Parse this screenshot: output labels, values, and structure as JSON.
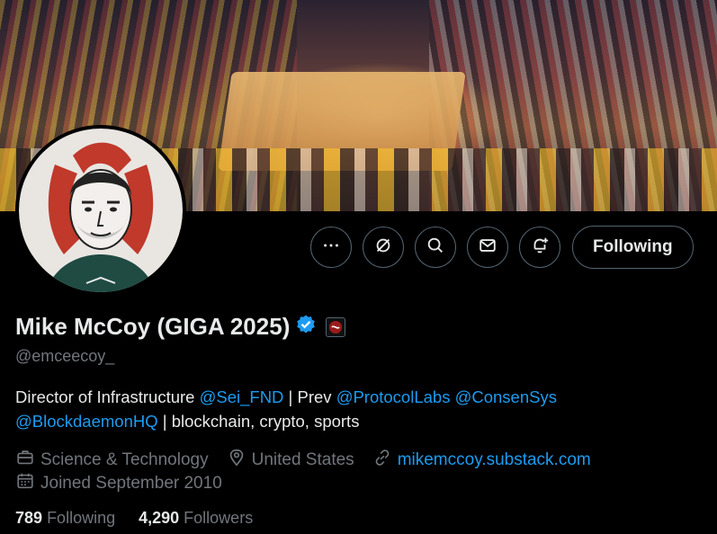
{
  "profile": {
    "name": "Mike McCoy (GIGA 2025)",
    "handle": "@emceecoy_",
    "bio_pre": "Director of Infrastructure ",
    "bio_link1": "@Sei_FND",
    "bio_mid1": " | Prev ",
    "bio_link2": "@ProtocolLabs",
    "bio_mid2": " ",
    "bio_link3": "@ConsenSys",
    "bio_link4": "@BlockdaemonHQ",
    "bio_post": " | blockchain, crypto, sports",
    "category": "Science & Technology",
    "location": "United States",
    "website": "mikemccoy.substack.com",
    "joined": "Joined September 2010",
    "following_count": "789",
    "following_label": "Following",
    "followers_count": "4,290",
    "followers_label": "Followers"
  },
  "actions": {
    "follow_label": "Following",
    "icons": [
      "more-icon",
      "grok-icon",
      "search-icon",
      "message-icon",
      "notify-icon"
    ]
  },
  "colors": {
    "background": "#000000",
    "text": "#e7e9ea",
    "muted": "#71767b",
    "link": "#1d9bf0",
    "border": "#536471",
    "verified": "#1d9bf0"
  }
}
